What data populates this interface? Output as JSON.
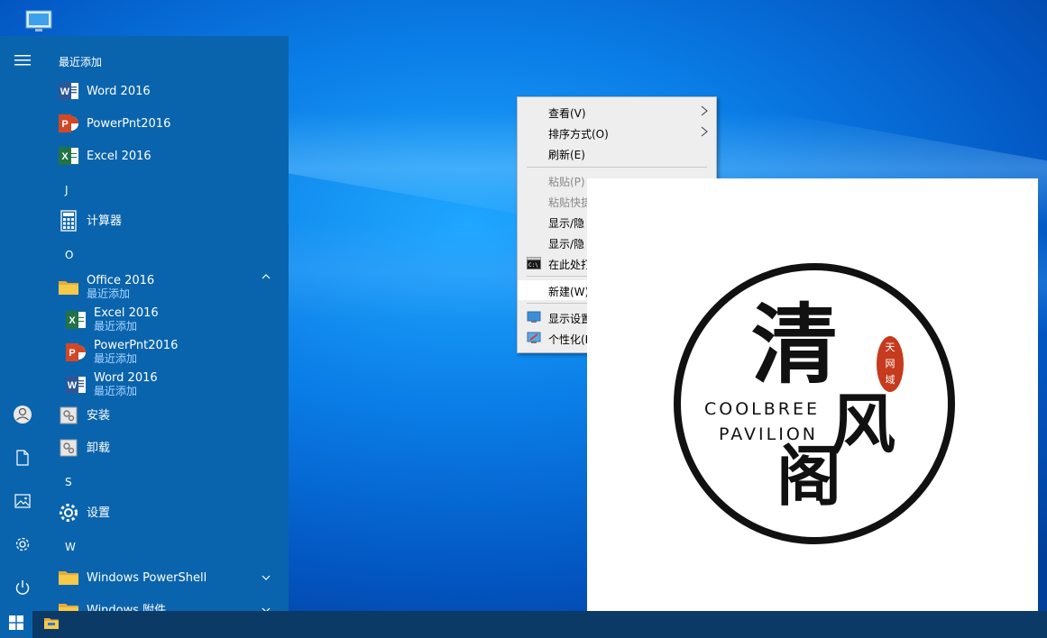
{
  "start_menu": {
    "recent_header": "最近添加",
    "recent_apps": [
      {
        "label": "Word 2016",
        "icon": "word-icon"
      },
      {
        "label": "PowerPnt2016",
        "icon": "powerpoint-icon"
      },
      {
        "label": "Excel 2016",
        "icon": "excel-icon"
      }
    ],
    "letters": {
      "j": "J",
      "o": "O",
      "s": "S",
      "w": "W"
    },
    "calculator": {
      "label": "计算器"
    },
    "office_folder": {
      "label": "Office 2016",
      "badge": "最近添加"
    },
    "office_children": [
      {
        "label": "Excel 2016",
        "badge": "最近添加",
        "icon": "excel-icon"
      },
      {
        "label": "PowerPnt2016",
        "badge": "最近添加",
        "icon": "powerpoint-icon"
      },
      {
        "label": "Word 2016",
        "badge": "最近添加",
        "icon": "word-icon"
      }
    ],
    "install": {
      "label": "安装"
    },
    "uninstall": {
      "label": "卸载"
    },
    "settings": {
      "label": "设置"
    },
    "powershell": {
      "label": "Windows PowerShell"
    },
    "accessories": {
      "label": "Windows 附件"
    }
  },
  "context_menu": {
    "items": [
      {
        "label": "查看(V)"
      },
      {
        "label": "排序方式(O)"
      },
      {
        "label": "刷新(E)"
      },
      {
        "label": "粘贴(P)"
      },
      {
        "label": "粘贴快捷"
      },
      {
        "label": "显示/隐"
      },
      {
        "label": "显示/隐"
      },
      {
        "label": "在此处打"
      },
      {
        "label": "新建(W)"
      },
      {
        "label": "显示设置"
      },
      {
        "label": "个性化(R"
      }
    ]
  },
  "logo": {
    "char1": "清",
    "char2": "风",
    "char3": "阁",
    "english_line1": "COOLBREE",
    "english_line2": "PAVILION",
    "seal_chars": [
      "天",
      "网",
      "域"
    ]
  },
  "colors": {
    "start_menu_bg": "#0a64ad",
    "taskbar_bg": "#0b3a66",
    "accent": "#0a7de6"
  }
}
